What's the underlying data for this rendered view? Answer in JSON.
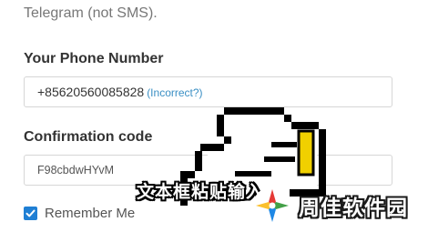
{
  "intro_text": "Telegram (not SMS).",
  "phone": {
    "label": "Your Phone Number",
    "value": "+85620560085828",
    "incorrect_link": "(Incorrect?)"
  },
  "code": {
    "label": "Confirmation code",
    "value": "F98cbdwHYvM"
  },
  "remember": {
    "label": "Remember Me",
    "checked": true
  },
  "overlay": {
    "subtitle": "文本框粘贴输入",
    "watermark_text": "周佳软件园",
    "cursor_icon": "pointing-hand-icon"
  },
  "colors": {
    "link": "#3a8fc4",
    "checkbox": "#1f7fd4",
    "cursor_fill": "#f0d000"
  }
}
